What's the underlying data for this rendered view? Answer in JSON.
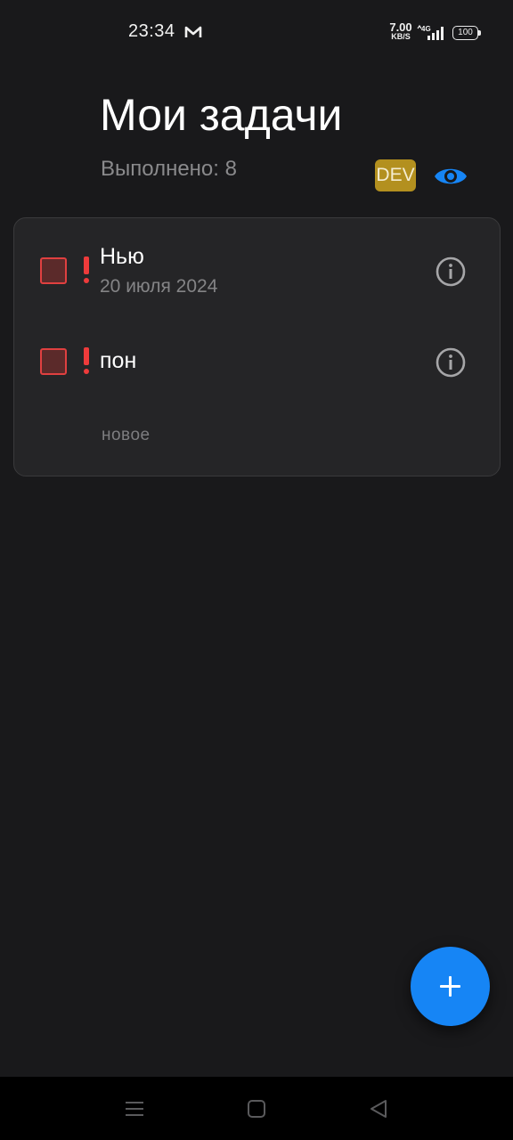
{
  "status_bar": {
    "time": "23:34",
    "notification_icon": "gmail-icon",
    "net_speed_value": "7.00",
    "net_speed_unit": "KB/S",
    "network_label": "4G",
    "battery_level": "100"
  },
  "header": {
    "title": "Мои задачи",
    "done_counter": "Выполнено: 8",
    "dev_badge": "DEV",
    "visibility_icon": "eye-icon"
  },
  "tasks": [
    {
      "title": "Нью",
      "date": "20 июля 2024",
      "priority": "high",
      "checked": false
    },
    {
      "title": "пон",
      "date": "",
      "priority": "high",
      "checked": false
    }
  ],
  "new_task_label": "новое",
  "fab": {
    "icon": "plus-icon"
  },
  "nav_bar": {
    "buttons": [
      "menu-icon",
      "home-icon",
      "back-icon"
    ]
  },
  "colors": {
    "background": "#19191b",
    "card": "#252527",
    "accent": "#1685f5",
    "priority": "#ee3b3b",
    "dev_badge": "#b3901f"
  }
}
